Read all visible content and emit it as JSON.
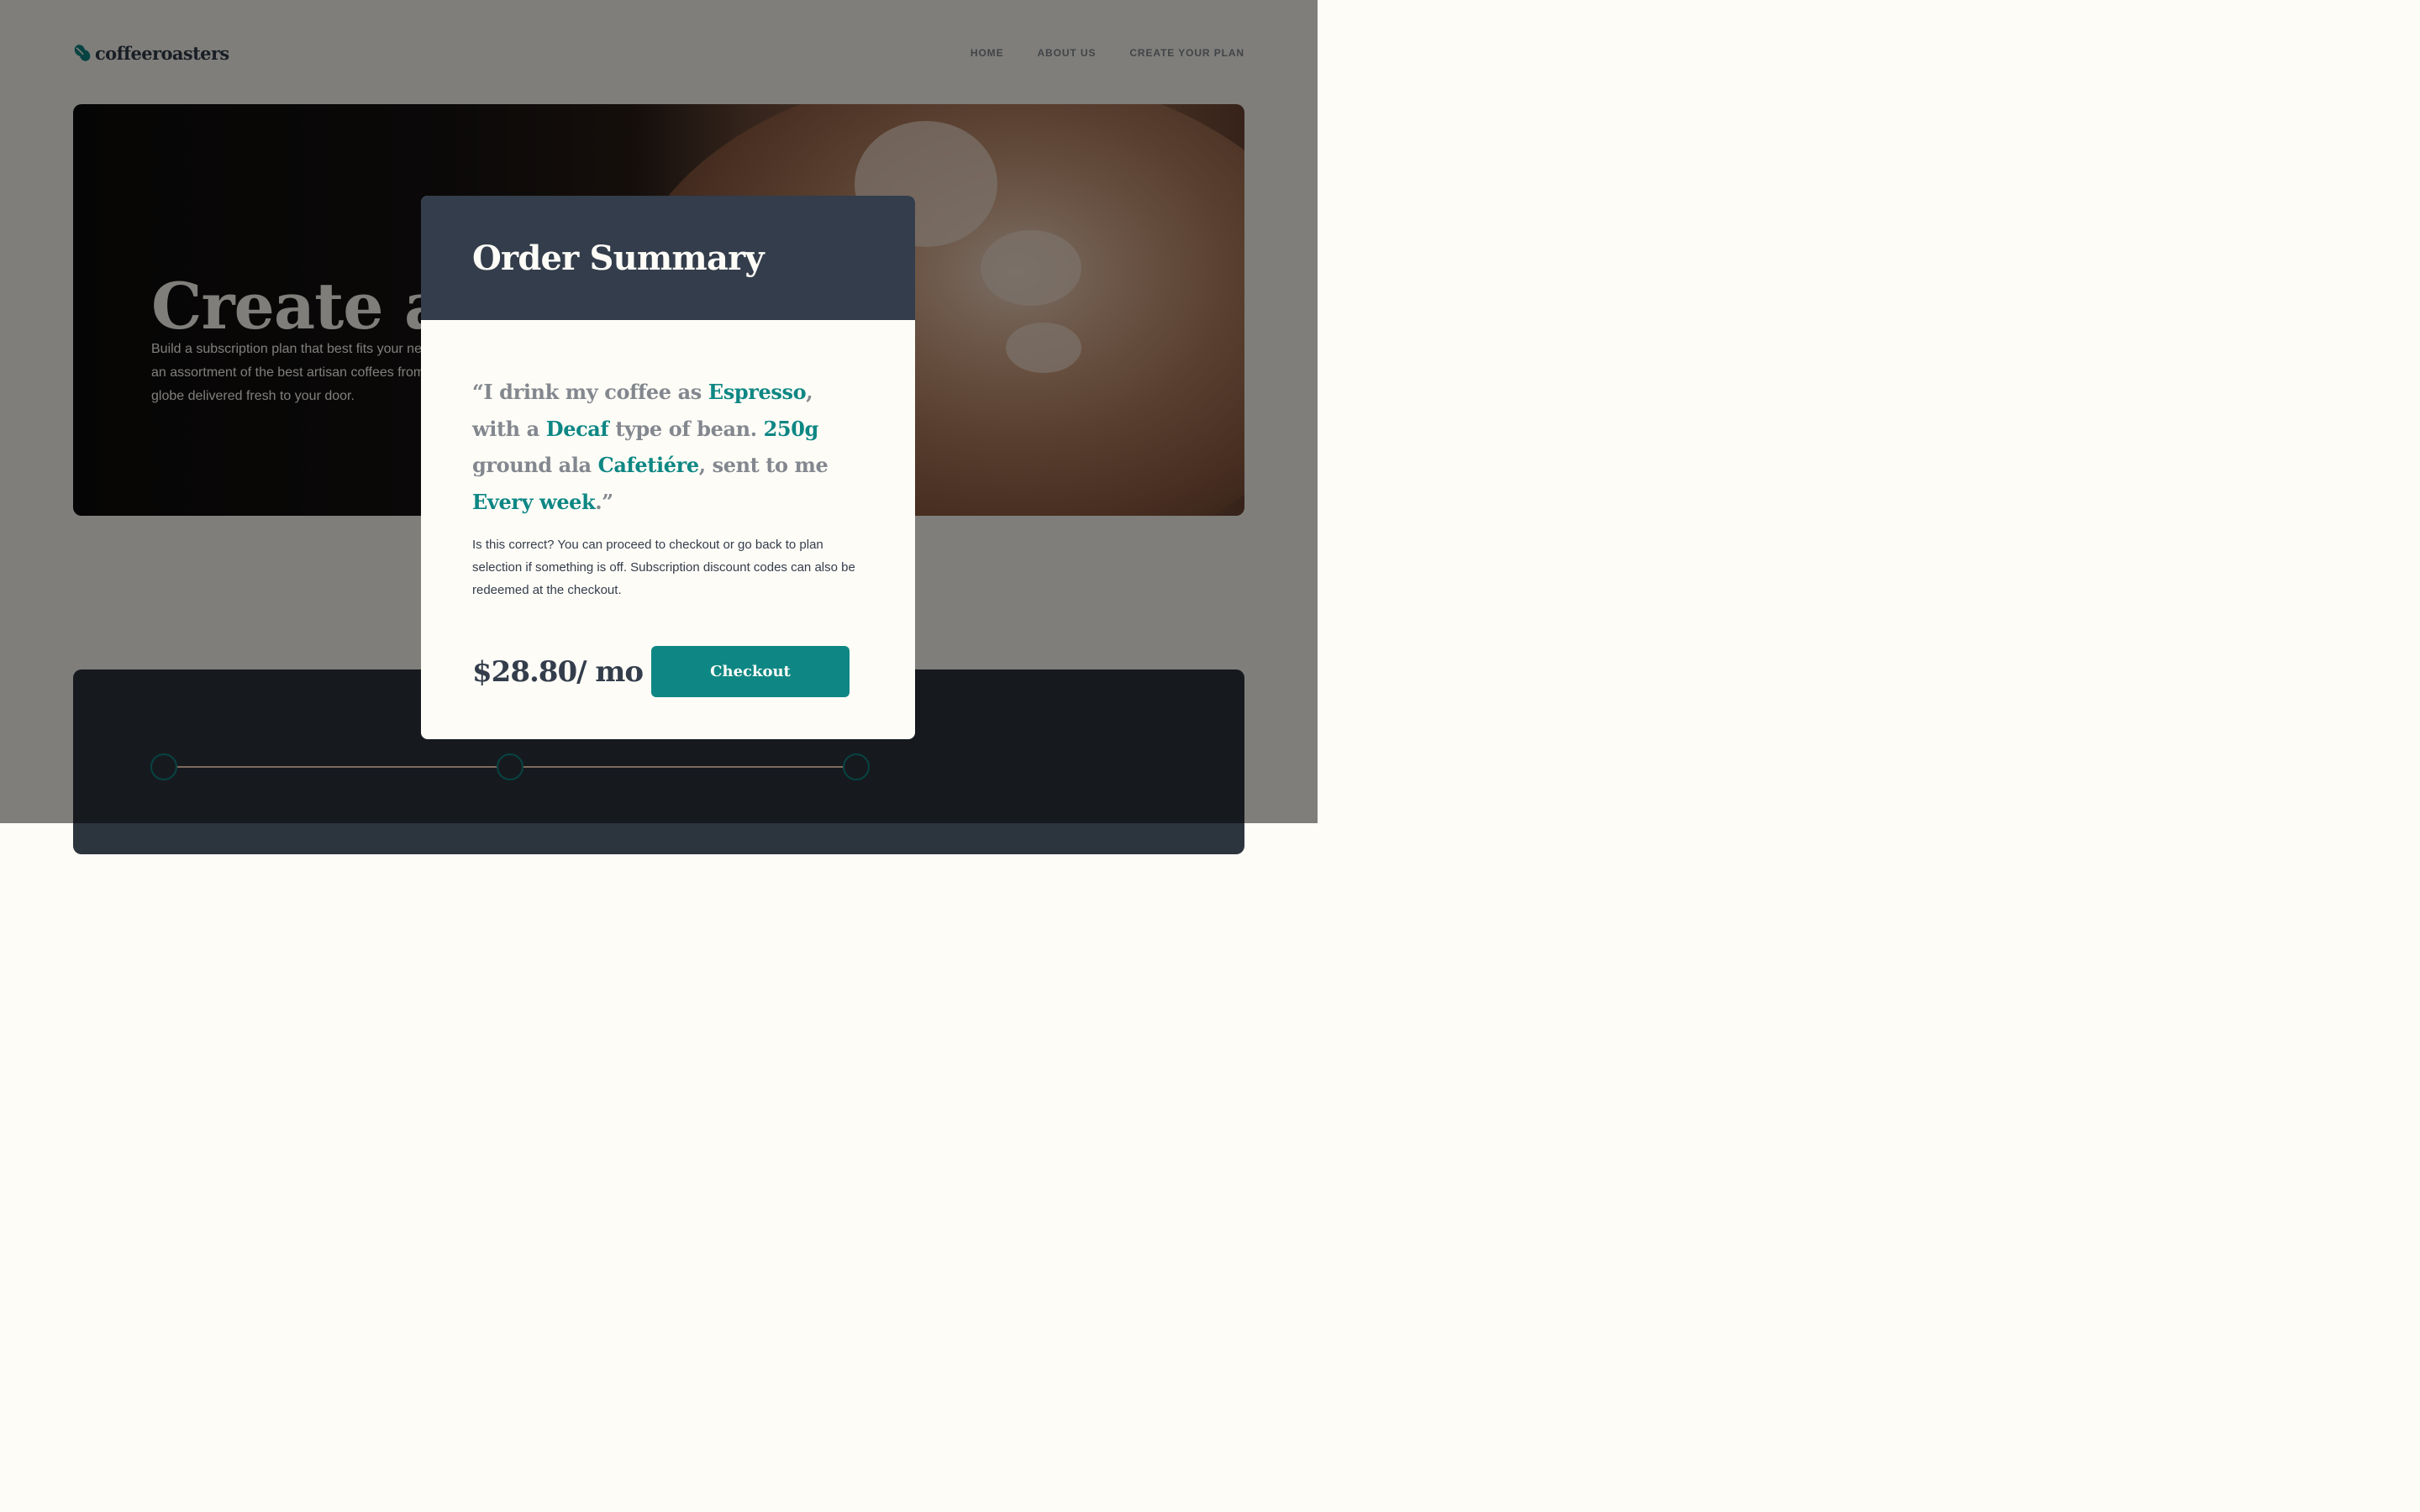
{
  "brand": {
    "name": "coffeeroasters"
  },
  "nav": {
    "items": [
      "HOME",
      "ABOUT US",
      "CREATE YOUR PLAN"
    ]
  },
  "hero": {
    "title": "Create a plan",
    "text": "Build a subscription plan that best fits your needs. We offer an assortment of the best artisan coffees from around the globe delivered fresh to your door."
  },
  "modal": {
    "title": "Order Summary",
    "summary": {
      "p1": "“I drink my coffee as ",
      "drink": "Espresso",
      "p2": ", with a ",
      "type": "Decaf",
      "p3": " type of bean. ",
      "quantity": "250g",
      "p4": " ground ala ",
      "grind": "Cafetiére",
      "p5": ", sent to me ",
      "frequency": "Every week",
      "p6": ".”"
    },
    "note": "Is this correct? You can proceed to checkout or go back to plan selection if something is off. Subscription discount codes can also be redeemed at the checkout.",
    "price": "$28.80/ mo",
    "checkout_label": "Checkout"
  },
  "colors": {
    "accent": "#0e8784",
    "dark": "#333d4b",
    "cream": "#fefcf7",
    "grey": "#83888f"
  }
}
